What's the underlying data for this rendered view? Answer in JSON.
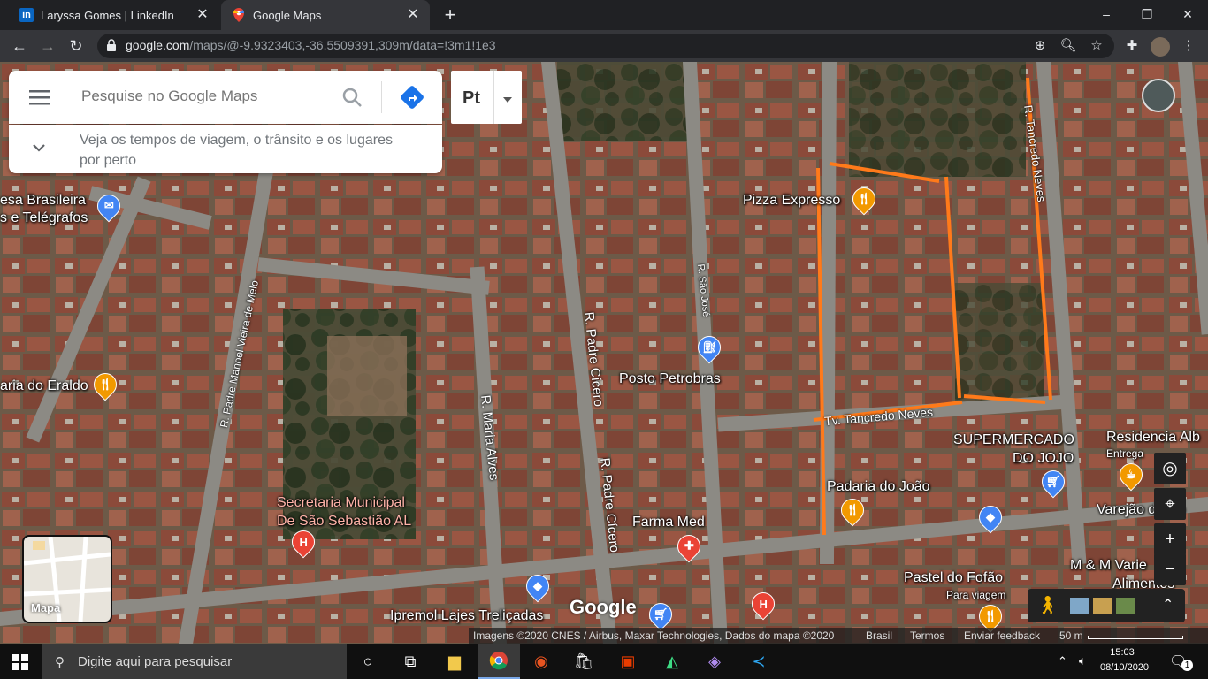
{
  "browser": {
    "tabs": [
      {
        "title": "Laryssa Gomes | LinkedIn",
        "icon": "linkedin-icon",
        "active": false
      },
      {
        "title": "Google Maps",
        "icon": "google-maps-icon",
        "active": true
      }
    ],
    "new_tab": "+",
    "window_controls": [
      "–",
      "❐",
      "✕"
    ],
    "url_host": "google.com",
    "url_path": "/maps/@-9.9323403,-36.5509391,309m/data=!3m1!1e3"
  },
  "maps": {
    "search_placeholder": "Pesquise no Google Maps",
    "travel_prompt": "Veja os tempos de viagem, o trânsito e os lugares por perto",
    "lang_label": "Pt",
    "layer_label": "Mapa",
    "google_logo": "Google",
    "attribution": "Imagens ©2020 CNES / Airbus, Maxar Technologies, Dados do mapa ©2020",
    "region": "Brasil",
    "terms": "Termos",
    "feedback": "Enviar feedback",
    "scale": "50 m",
    "places": [
      {
        "name": "Pizza Expresso"
      },
      {
        "name": "Posto Petrobras"
      },
      {
        "name": "Padaria do João"
      },
      {
        "name": "Farma Med"
      },
      {
        "name": "Pastel do Fofão"
      },
      {
        "name": "Para viagem"
      },
      {
        "name": "Ipremol Lajes Treliçadas"
      },
      {
        "name": "Secretaria Municipal"
      },
      {
        "name": "De São Sebastião AL"
      },
      {
        "name": "SUPERMERCADO"
      },
      {
        "name": "DO JOJO"
      },
      {
        "name": "Residencia Alb"
      },
      {
        "name": "Entrega"
      },
      {
        "name": "Varejão do Po"
      },
      {
        "name": "M & M Varie"
      },
      {
        "name": "Alimentos"
      },
      {
        "name": "esa Brasileira"
      },
      {
        "name": "s e Telégrafos"
      },
      {
        "name": "aria do Eraldo"
      }
    ],
    "streets": [
      {
        "name": "R. Tancredo Neves"
      },
      {
        "name": "Tv. Tancredo Neves"
      },
      {
        "name": "R. São José"
      },
      {
        "name": "R. Padre Cícero"
      },
      {
        "name": "R. Padre Cícero"
      },
      {
        "name": "R. Maria Alves"
      },
      {
        "name": "R. Padre Manoel Vieira de Melo"
      }
    ],
    "colors": {
      "annotation": "#ff7a1a",
      "food_pin": "#f29900",
      "health_pin": "#ea4335",
      "shop_pin": "#4285f4"
    }
  },
  "taskbar": {
    "search_placeholder": "Digite aqui para pesquisar",
    "time": "15:03",
    "date": "08/10/2020",
    "notifications": "1"
  }
}
